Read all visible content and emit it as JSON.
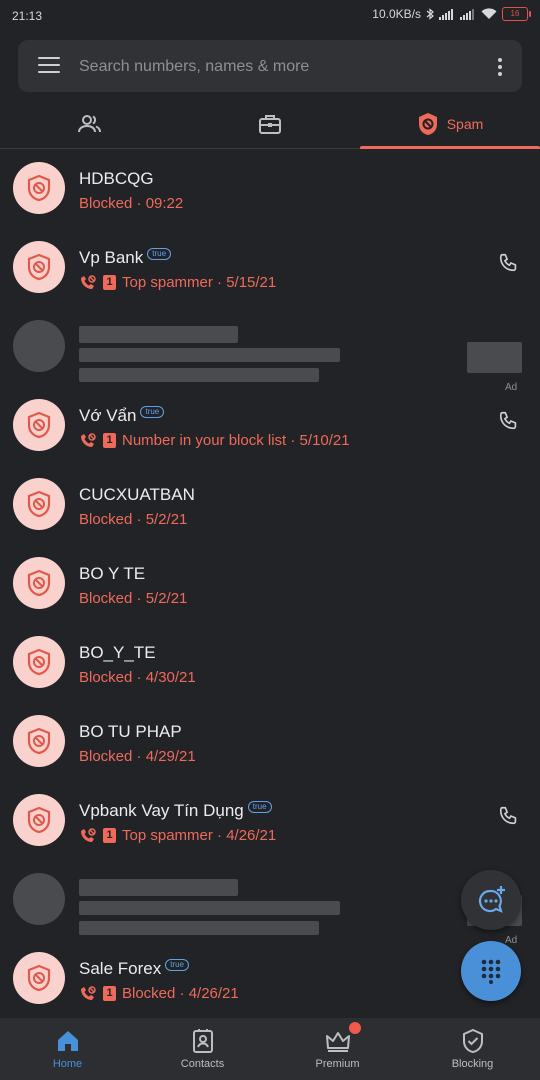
{
  "status": {
    "time": "21:13",
    "speed": "10.0KB/s",
    "battery": "16"
  },
  "search": {
    "placeholder": "Search numbers, names & more"
  },
  "tabs": [
    {
      "icon": "contacts-icon",
      "label": ""
    },
    {
      "icon": "briefcase-icon",
      "label": ""
    },
    {
      "icon": "spam-shield-icon",
      "label": "Spam"
    }
  ],
  "rows": [
    {
      "name": "HDBCQG",
      "badge": "",
      "count": "",
      "status": "Blocked · 09:22",
      "call": false
    },
    {
      "name": "Vp Bank",
      "badge": "true",
      "count": "1",
      "status": "Top spammer · 5/15/21",
      "call": true
    },
    {
      "ad": true,
      "ad_label": "Ad"
    },
    {
      "name": "Vớ Vẩn",
      "badge": "true",
      "count": "1",
      "status": "Number in your block list · 5/10/21",
      "call": true
    },
    {
      "name": "CUCXUATBAN",
      "badge": "",
      "count": "",
      "status": "Blocked · 5/2/21",
      "call": false
    },
    {
      "name": "BO Y TE",
      "badge": "",
      "count": "",
      "status": "Blocked · 5/2/21",
      "call": false
    },
    {
      "name": "BO_Y_TE",
      "badge": "",
      "count": "",
      "status": "Blocked · 4/30/21",
      "call": false
    },
    {
      "name": "BO TU PHAP",
      "badge": "",
      "count": "",
      "status": "Blocked · 4/29/21",
      "call": false
    },
    {
      "name": "Vpbank Vay Tín Dụng",
      "badge": "true",
      "count": "1",
      "status": "Top spammer · 4/26/21",
      "call": true
    },
    {
      "ad": true,
      "ad_label": "Ad"
    },
    {
      "name": "Sale Forex",
      "badge": "true",
      "count": "1",
      "status": "Blocked · 4/26/21",
      "call": true
    }
  ],
  "nav": [
    {
      "label": "Home",
      "icon": "home-icon",
      "active": true
    },
    {
      "label": "Contacts",
      "icon": "contacts-card-icon",
      "active": false
    },
    {
      "label": "Premium",
      "icon": "crown-icon",
      "active": false
    },
    {
      "label": "Blocking",
      "icon": "shield-check-icon",
      "active": false
    }
  ],
  "colors": {
    "accent": "#ef6a5a",
    "blue": "#4a90d9",
    "background": "#222326"
  }
}
